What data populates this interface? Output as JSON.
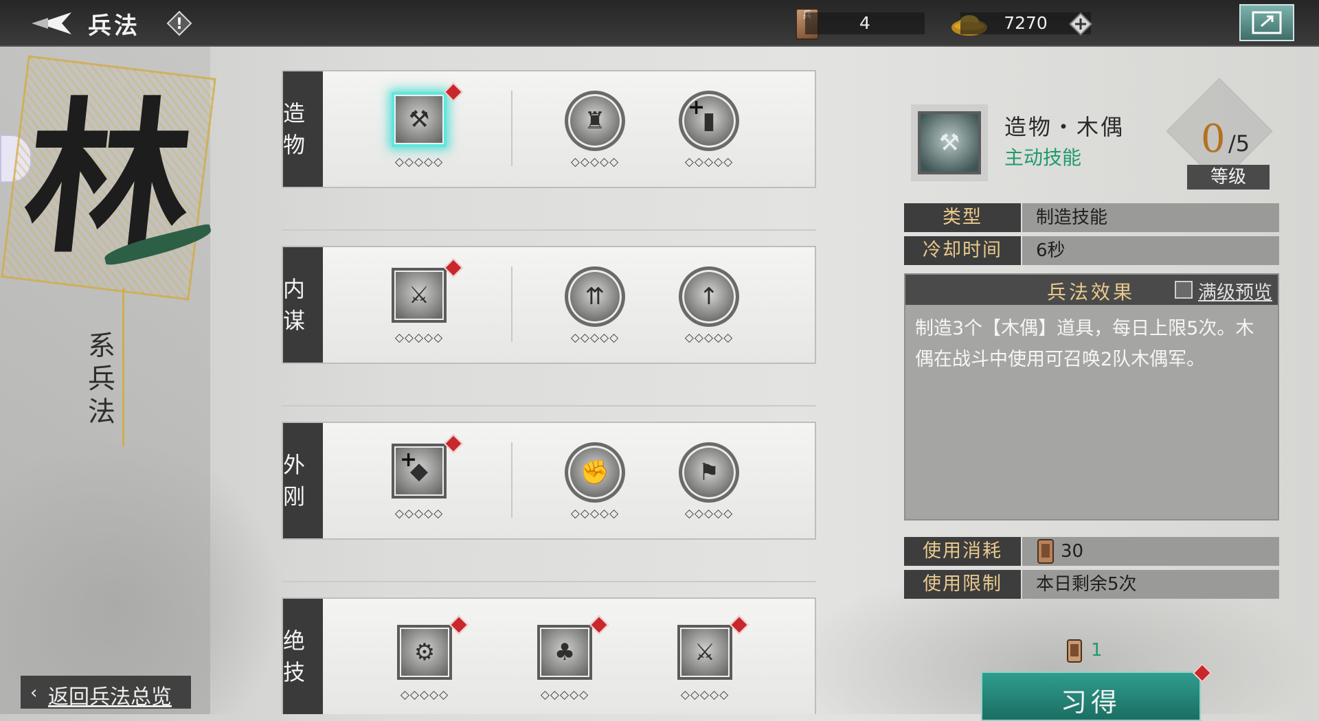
{
  "topbar": {
    "title": "兵法",
    "troop_token": {
      "icon": "兵",
      "value": "4"
    },
    "gold": {
      "value": "7270"
    }
  },
  "school": {
    "char": "林",
    "subtitle": "系兵法"
  },
  "return_button": {
    "label": "返回兵法总览"
  },
  "rows": [
    {
      "label": "造物",
      "nodes": [
        {
          "icon": "puppet-axe-icon",
          "shape": "square",
          "selected": true,
          "red_dot": true,
          "diamonds": "◇◇◇◇◇"
        },
        {
          "icon": "puppet-soldier-icon",
          "shape": "round",
          "diamonds": "◇◇◇◇◇"
        },
        {
          "icon": "token-plus-icon",
          "shape": "round",
          "diamonds": "◇◇◇◇◇"
        }
      ]
    },
    {
      "label": "内谋",
      "nodes": [
        {
          "icon": "warrior-blades-icon",
          "shape": "square",
          "red_dot": true,
          "diamonds": "◇◇◇◇◇"
        },
        {
          "icon": "hammer-arrows-icon",
          "shape": "round",
          "diamonds": "◇◇◇◇◇"
        },
        {
          "icon": "token-up-icon",
          "shape": "round",
          "diamonds": "◇◇◇◇◇"
        }
      ]
    },
    {
      "label": "外刚",
      "nodes": [
        {
          "icon": "stone-plus-icon",
          "shape": "square",
          "red_dot": true,
          "diamonds": "◇◇◇◇◇"
        },
        {
          "icon": "handshake-icon",
          "shape": "round",
          "diamonds": "◇◇◇◇◇"
        },
        {
          "icon": "banner-troops-icon",
          "shape": "round",
          "diamonds": "◇◇◇◇◇"
        }
      ]
    },
    {
      "label": "绝技",
      "nodes": [
        {
          "icon": "war-chariot-icon",
          "shape": "square",
          "red_dot": true,
          "diamonds": "◇◇◇◇◇"
        },
        {
          "icon": "forest-icon",
          "shape": "square",
          "red_dot": true,
          "diamonds": "◇◇◇◇◇"
        },
        {
          "icon": "warrior-charge-icon",
          "shape": "square",
          "red_dot": true,
          "diamonds": "◇◇◇◇◇"
        }
      ]
    }
  ],
  "detail": {
    "name": "造物・木偶",
    "kind": "主动技能",
    "level": {
      "current": "0",
      "max": "/5",
      "label": "等级"
    },
    "type": {
      "key": "类型",
      "value": "制造技能"
    },
    "cooldown": {
      "key": "冷却时间",
      "value": "6秒"
    },
    "effect": {
      "title": "兵法效果",
      "preview_label": "满级预览",
      "text": "制造3个【木偶】道具，每日上限5次。木偶在战斗中使用可召唤2队木偶军。"
    },
    "usage_cost": {
      "key": "使用消耗",
      "value": "30"
    },
    "usage_limit": {
      "key": "使用限制",
      "value": "本日剩余5次"
    },
    "learn": {
      "cost": "1",
      "label": "习得"
    }
  },
  "colors": {
    "accent_green": "#1f9b6c",
    "selected_glow": "#5de8de",
    "red_dot": "#c8282b",
    "level_orange": "#b5701e"
  }
}
